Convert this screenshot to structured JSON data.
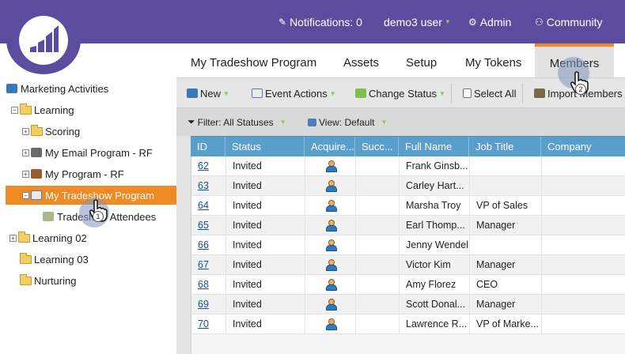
{
  "topbar": {
    "notifications": "Notifications: 0",
    "user": "demo3 user",
    "admin": "Admin",
    "community": "Community"
  },
  "tree": {
    "root": "Marketing Activities",
    "items": [
      {
        "label": "Learning"
      },
      {
        "label": "Scoring"
      },
      {
        "label": "My Email Program - RF"
      },
      {
        "label": "My Program - RF"
      },
      {
        "label": "My Tradeshow Program"
      },
      {
        "label": "Tradeshow Attendees"
      },
      {
        "label": "Learning 02"
      },
      {
        "label": "Learning 03"
      },
      {
        "label": "Nurturing"
      }
    ]
  },
  "tabs": [
    "My Tradeshow Program",
    "Assets",
    "Setup",
    "My Tokens",
    "Members"
  ],
  "toolbar": {
    "new": "New",
    "event_actions": "Event Actions",
    "change_status": "Change Status",
    "select_all": "Select All",
    "import_members": "Import Members"
  },
  "filters": {
    "filter": "Filter: All Statuses",
    "view": "View: Default"
  },
  "grid": {
    "columns": [
      "ID",
      "Status",
      "Acquire...",
      "Succ...",
      "Full Name",
      "Job Title",
      "Company"
    ],
    "rows": [
      {
        "id": "62",
        "status": "Invited",
        "name": "Frank Ginsb...",
        "title": ""
      },
      {
        "id": "63",
        "status": "Invited",
        "name": "Carley Hart...",
        "title": ""
      },
      {
        "id": "64",
        "status": "Invited",
        "name": "Marsha Troy",
        "title": "VP of Sales"
      },
      {
        "id": "65",
        "status": "Invited",
        "name": "Earl Thomp...",
        "title": "Manager"
      },
      {
        "id": "66",
        "status": "Invited",
        "name": "Jenny Wendel",
        "title": ""
      },
      {
        "id": "67",
        "status": "Invited",
        "name": "Victor Kim",
        "title": "Manager"
      },
      {
        "id": "68",
        "status": "Invited",
        "name": "Amy Florez",
        "title": "CEO"
      },
      {
        "id": "69",
        "status": "Invited",
        "name": "Scott Donal...",
        "title": "Manager"
      },
      {
        "id": "70",
        "status": "Invited",
        "name": "Lawrence R...",
        "title": "VP of Marke..."
      }
    ]
  },
  "steps": {
    "one": "1",
    "two": "2"
  },
  "colors": {
    "brand": "#5c4c9f",
    "accent": "#f08a24",
    "grid_header": "#5a9fc9"
  }
}
